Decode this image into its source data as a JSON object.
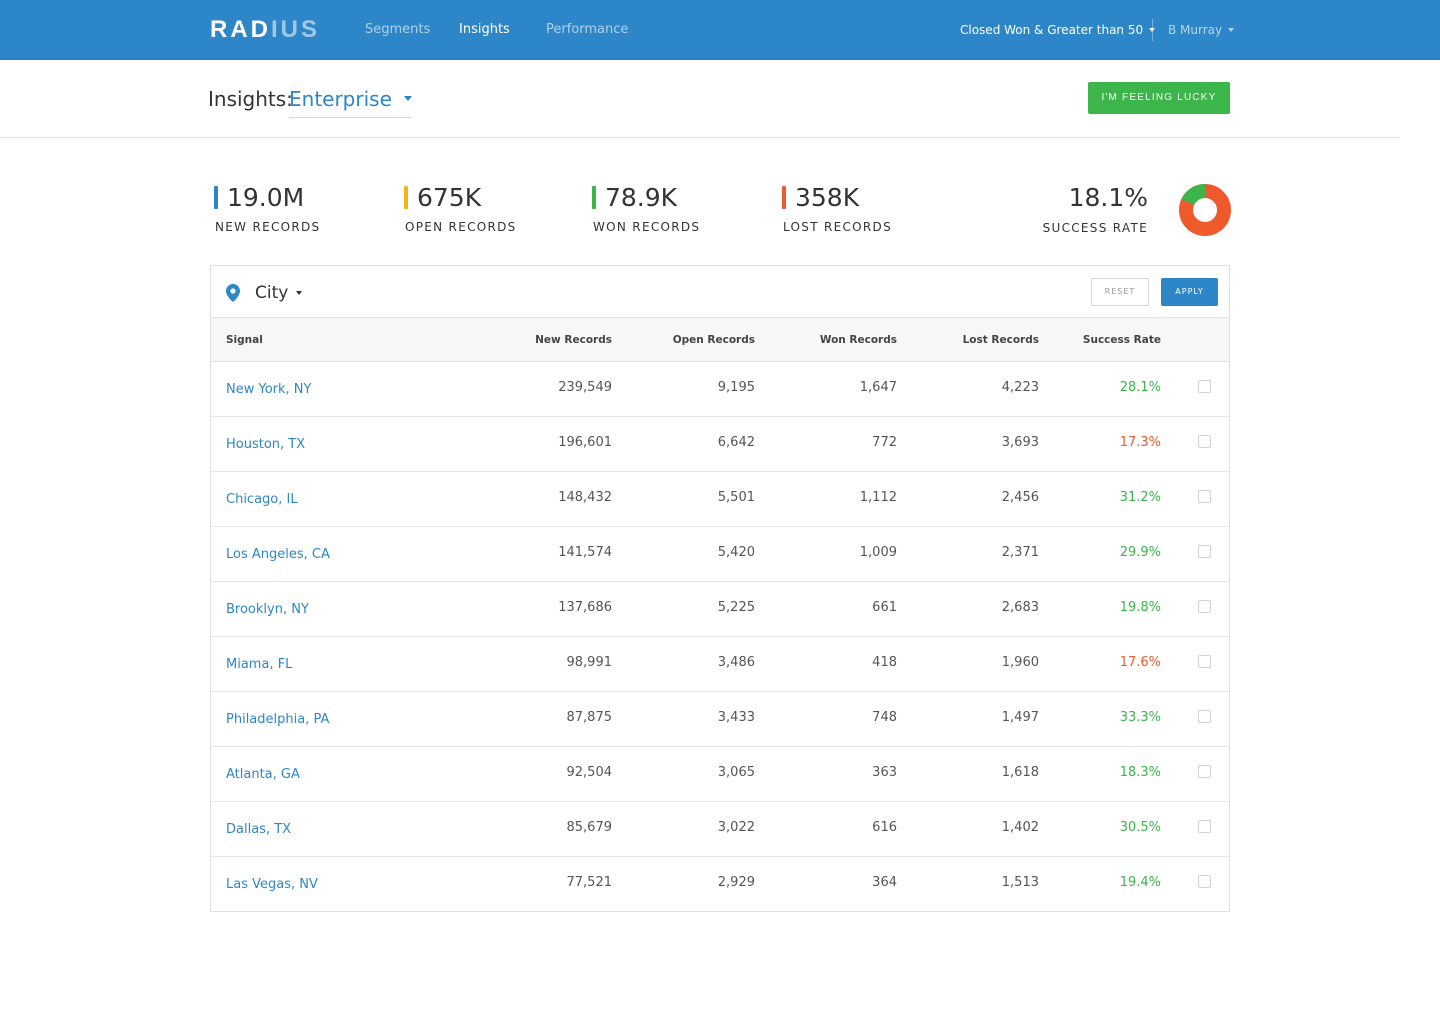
{
  "nav": {
    "logo_primary": "RAD",
    "logo_dim": "IUS",
    "links": [
      "Segments",
      "Insights",
      "Performance"
    ],
    "filter_label": "Closed Won & Greater than 50",
    "user_label": "B Murray"
  },
  "header": {
    "title": "Insights:",
    "segment": "Enterprise",
    "lucky_button": "I'M FEELING LUCKY"
  },
  "stats": [
    {
      "value": "19.0M",
      "label": "NEW RECORDS",
      "color": "#2d86c8"
    },
    {
      "value": "675K",
      "label": "OPEN RECORDS",
      "color": "#f5b21b"
    },
    {
      "value": "78.9K",
      "label": "WON RECORDS",
      "color": "#3cb54a"
    },
    {
      "value": "358K",
      "label": "LOST RECORDS",
      "color": "#ee5a2c"
    }
  ],
  "success": {
    "value": "18.1%",
    "label": "SUCCESS RATE",
    "fraction": 0.181,
    "won_color": "#3cb54a",
    "lost_color": "#ee5a2c"
  },
  "panel": {
    "filter_label": "City",
    "reset_label": "RESET",
    "apply_label": "APPLY",
    "columns": [
      "Signal",
      "New Records",
      "Open Records",
      "Won Records",
      "Lost Records",
      "Success Rate"
    ],
    "rows": [
      {
        "signal": "New York, NY",
        "new": "239,549",
        "open": "9,195",
        "won": "1,647",
        "lost": "4,223",
        "rate": "28.1%",
        "status": "good"
      },
      {
        "signal": "Houston, TX",
        "new": "196,601",
        "open": "6,642",
        "won": "772",
        "lost": "3,693",
        "rate": "17.3%",
        "status": "bad"
      },
      {
        "signal": "Chicago, IL",
        "new": "148,432",
        "open": "5,501",
        "won": "1,112",
        "lost": "2,456",
        "rate": "31.2%",
        "status": "good"
      },
      {
        "signal": "Los Angeles, CA",
        "new": "141,574",
        "open": "5,420",
        "won": "1,009",
        "lost": "2,371",
        "rate": "29.9%",
        "status": "good"
      },
      {
        "signal": "Brooklyn, NY",
        "new": "137,686",
        "open": "5,225",
        "won": "661",
        "lost": "2,683",
        "rate": "19.8%",
        "status": "good"
      },
      {
        "signal": "Miama, FL",
        "new": "98,991",
        "open": "3,486",
        "won": "418",
        "lost": "1,960",
        "rate": "17.6%",
        "status": "bad"
      },
      {
        "signal": "Philadelphia, PA",
        "new": "87,875",
        "open": "3,433",
        "won": "748",
        "lost": "1,497",
        "rate": "33.3%",
        "status": "good"
      },
      {
        "signal": "Atlanta, GA",
        "new": "92,504",
        "open": "3,065",
        "won": "363",
        "lost": "1,618",
        "rate": "18.3%",
        "status": "good"
      },
      {
        "signal": "Dallas, TX",
        "new": "85,679",
        "open": "3,022",
        "won": "616",
        "lost": "1,402",
        "rate": "30.5%",
        "status": "good"
      },
      {
        "signal": "Las Vegas, NV",
        "new": "77,521",
        "open": "2,929",
        "won": "364",
        "lost": "1,513",
        "rate": "19.4%",
        "status": "good"
      }
    ]
  }
}
